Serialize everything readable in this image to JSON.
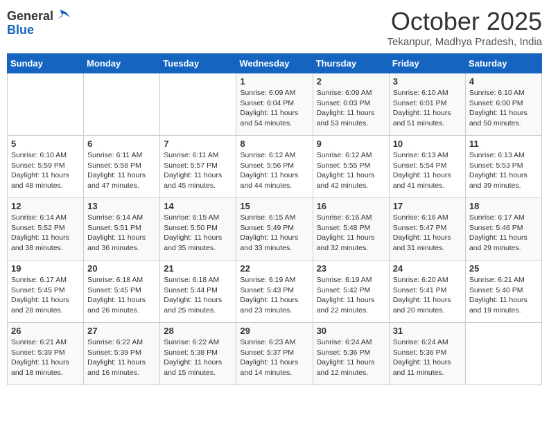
{
  "header": {
    "logo_general": "General",
    "logo_blue": "Blue",
    "month_title": "October 2025",
    "location": "Tekanpur, Madhya Pradesh, India"
  },
  "weekdays": [
    "Sunday",
    "Monday",
    "Tuesday",
    "Wednesday",
    "Thursday",
    "Friday",
    "Saturday"
  ],
  "weeks": [
    [
      {
        "day": "",
        "info": ""
      },
      {
        "day": "",
        "info": ""
      },
      {
        "day": "",
        "info": ""
      },
      {
        "day": "1",
        "info": "Sunrise: 6:09 AM\nSunset: 6:04 PM\nDaylight: 11 hours\nand 54 minutes."
      },
      {
        "day": "2",
        "info": "Sunrise: 6:09 AM\nSunset: 6:03 PM\nDaylight: 11 hours\nand 53 minutes."
      },
      {
        "day": "3",
        "info": "Sunrise: 6:10 AM\nSunset: 6:01 PM\nDaylight: 11 hours\nand 51 minutes."
      },
      {
        "day": "4",
        "info": "Sunrise: 6:10 AM\nSunset: 6:00 PM\nDaylight: 11 hours\nand 50 minutes."
      }
    ],
    [
      {
        "day": "5",
        "info": "Sunrise: 6:10 AM\nSunset: 5:59 PM\nDaylight: 11 hours\nand 48 minutes."
      },
      {
        "day": "6",
        "info": "Sunrise: 6:11 AM\nSunset: 5:58 PM\nDaylight: 11 hours\nand 47 minutes."
      },
      {
        "day": "7",
        "info": "Sunrise: 6:11 AM\nSunset: 5:57 PM\nDaylight: 11 hours\nand 45 minutes."
      },
      {
        "day": "8",
        "info": "Sunrise: 6:12 AM\nSunset: 5:56 PM\nDaylight: 11 hours\nand 44 minutes."
      },
      {
        "day": "9",
        "info": "Sunrise: 6:12 AM\nSunset: 5:55 PM\nDaylight: 11 hours\nand 42 minutes."
      },
      {
        "day": "10",
        "info": "Sunrise: 6:13 AM\nSunset: 5:54 PM\nDaylight: 11 hours\nand 41 minutes."
      },
      {
        "day": "11",
        "info": "Sunrise: 6:13 AM\nSunset: 5:53 PM\nDaylight: 11 hours\nand 39 minutes."
      }
    ],
    [
      {
        "day": "12",
        "info": "Sunrise: 6:14 AM\nSunset: 5:52 PM\nDaylight: 11 hours\nand 38 minutes."
      },
      {
        "day": "13",
        "info": "Sunrise: 6:14 AM\nSunset: 5:51 PM\nDaylight: 11 hours\nand 36 minutes."
      },
      {
        "day": "14",
        "info": "Sunrise: 6:15 AM\nSunset: 5:50 PM\nDaylight: 11 hours\nand 35 minutes."
      },
      {
        "day": "15",
        "info": "Sunrise: 6:15 AM\nSunset: 5:49 PM\nDaylight: 11 hours\nand 33 minutes."
      },
      {
        "day": "16",
        "info": "Sunrise: 6:16 AM\nSunset: 5:48 PM\nDaylight: 11 hours\nand 32 minutes."
      },
      {
        "day": "17",
        "info": "Sunrise: 6:16 AM\nSunset: 5:47 PM\nDaylight: 11 hours\nand 31 minutes."
      },
      {
        "day": "18",
        "info": "Sunrise: 6:17 AM\nSunset: 5:46 PM\nDaylight: 11 hours\nand 29 minutes."
      }
    ],
    [
      {
        "day": "19",
        "info": "Sunrise: 6:17 AM\nSunset: 5:45 PM\nDaylight: 11 hours\nand 28 minutes."
      },
      {
        "day": "20",
        "info": "Sunrise: 6:18 AM\nSunset: 5:45 PM\nDaylight: 11 hours\nand 26 minutes."
      },
      {
        "day": "21",
        "info": "Sunrise: 6:18 AM\nSunset: 5:44 PM\nDaylight: 11 hours\nand 25 minutes."
      },
      {
        "day": "22",
        "info": "Sunrise: 6:19 AM\nSunset: 5:43 PM\nDaylight: 11 hours\nand 23 minutes."
      },
      {
        "day": "23",
        "info": "Sunrise: 6:19 AM\nSunset: 5:42 PM\nDaylight: 11 hours\nand 22 minutes."
      },
      {
        "day": "24",
        "info": "Sunrise: 6:20 AM\nSunset: 5:41 PM\nDaylight: 11 hours\nand 20 minutes."
      },
      {
        "day": "25",
        "info": "Sunrise: 6:21 AM\nSunset: 5:40 PM\nDaylight: 11 hours\nand 19 minutes."
      }
    ],
    [
      {
        "day": "26",
        "info": "Sunrise: 6:21 AM\nSunset: 5:39 PM\nDaylight: 11 hours\nand 18 minutes."
      },
      {
        "day": "27",
        "info": "Sunrise: 6:22 AM\nSunset: 5:39 PM\nDaylight: 11 hours\nand 16 minutes."
      },
      {
        "day": "28",
        "info": "Sunrise: 6:22 AM\nSunset: 5:38 PM\nDaylight: 11 hours\nand 15 minutes."
      },
      {
        "day": "29",
        "info": "Sunrise: 6:23 AM\nSunset: 5:37 PM\nDaylight: 11 hours\nand 14 minutes."
      },
      {
        "day": "30",
        "info": "Sunrise: 6:24 AM\nSunset: 5:36 PM\nDaylight: 11 hours\nand 12 minutes."
      },
      {
        "day": "31",
        "info": "Sunrise: 6:24 AM\nSunset: 5:36 PM\nDaylight: 11 hours\nand 11 minutes."
      },
      {
        "day": "",
        "info": ""
      }
    ]
  ]
}
